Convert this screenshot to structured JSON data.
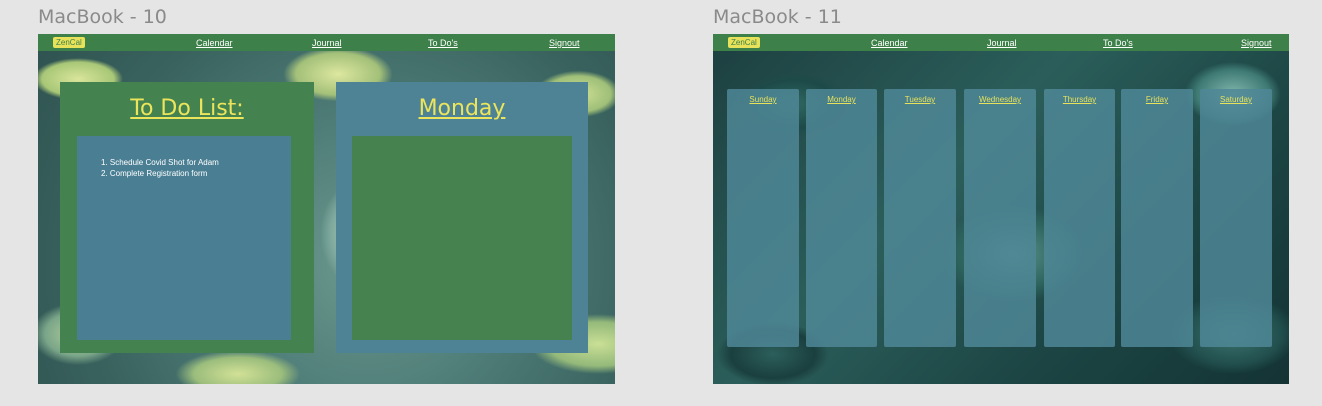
{
  "frames": [
    {
      "title": "MacBook - 10"
    },
    {
      "title": "MacBook - 11"
    }
  ],
  "navbar": {
    "logo": "ZenCal",
    "items": [
      "Calendar",
      "Journal",
      "To Do's",
      "Signout"
    ]
  },
  "todo": {
    "heading": "To Do List:",
    "items": [
      "1. Schedule Covid Shot for Adam",
      "2. Complete Registration form"
    ]
  },
  "day_panel": {
    "heading": "Monday"
  },
  "week": {
    "days": [
      "Sunday",
      "Monday",
      "Tuesday",
      "Wednesday",
      "Thursday",
      "Friday",
      "Saturday"
    ]
  },
  "colors": {
    "nav_bg": "#3e8049",
    "accent_yellow": "#ece55c",
    "panel_green": "#44834f",
    "panel_blue": "#4a7f93"
  }
}
